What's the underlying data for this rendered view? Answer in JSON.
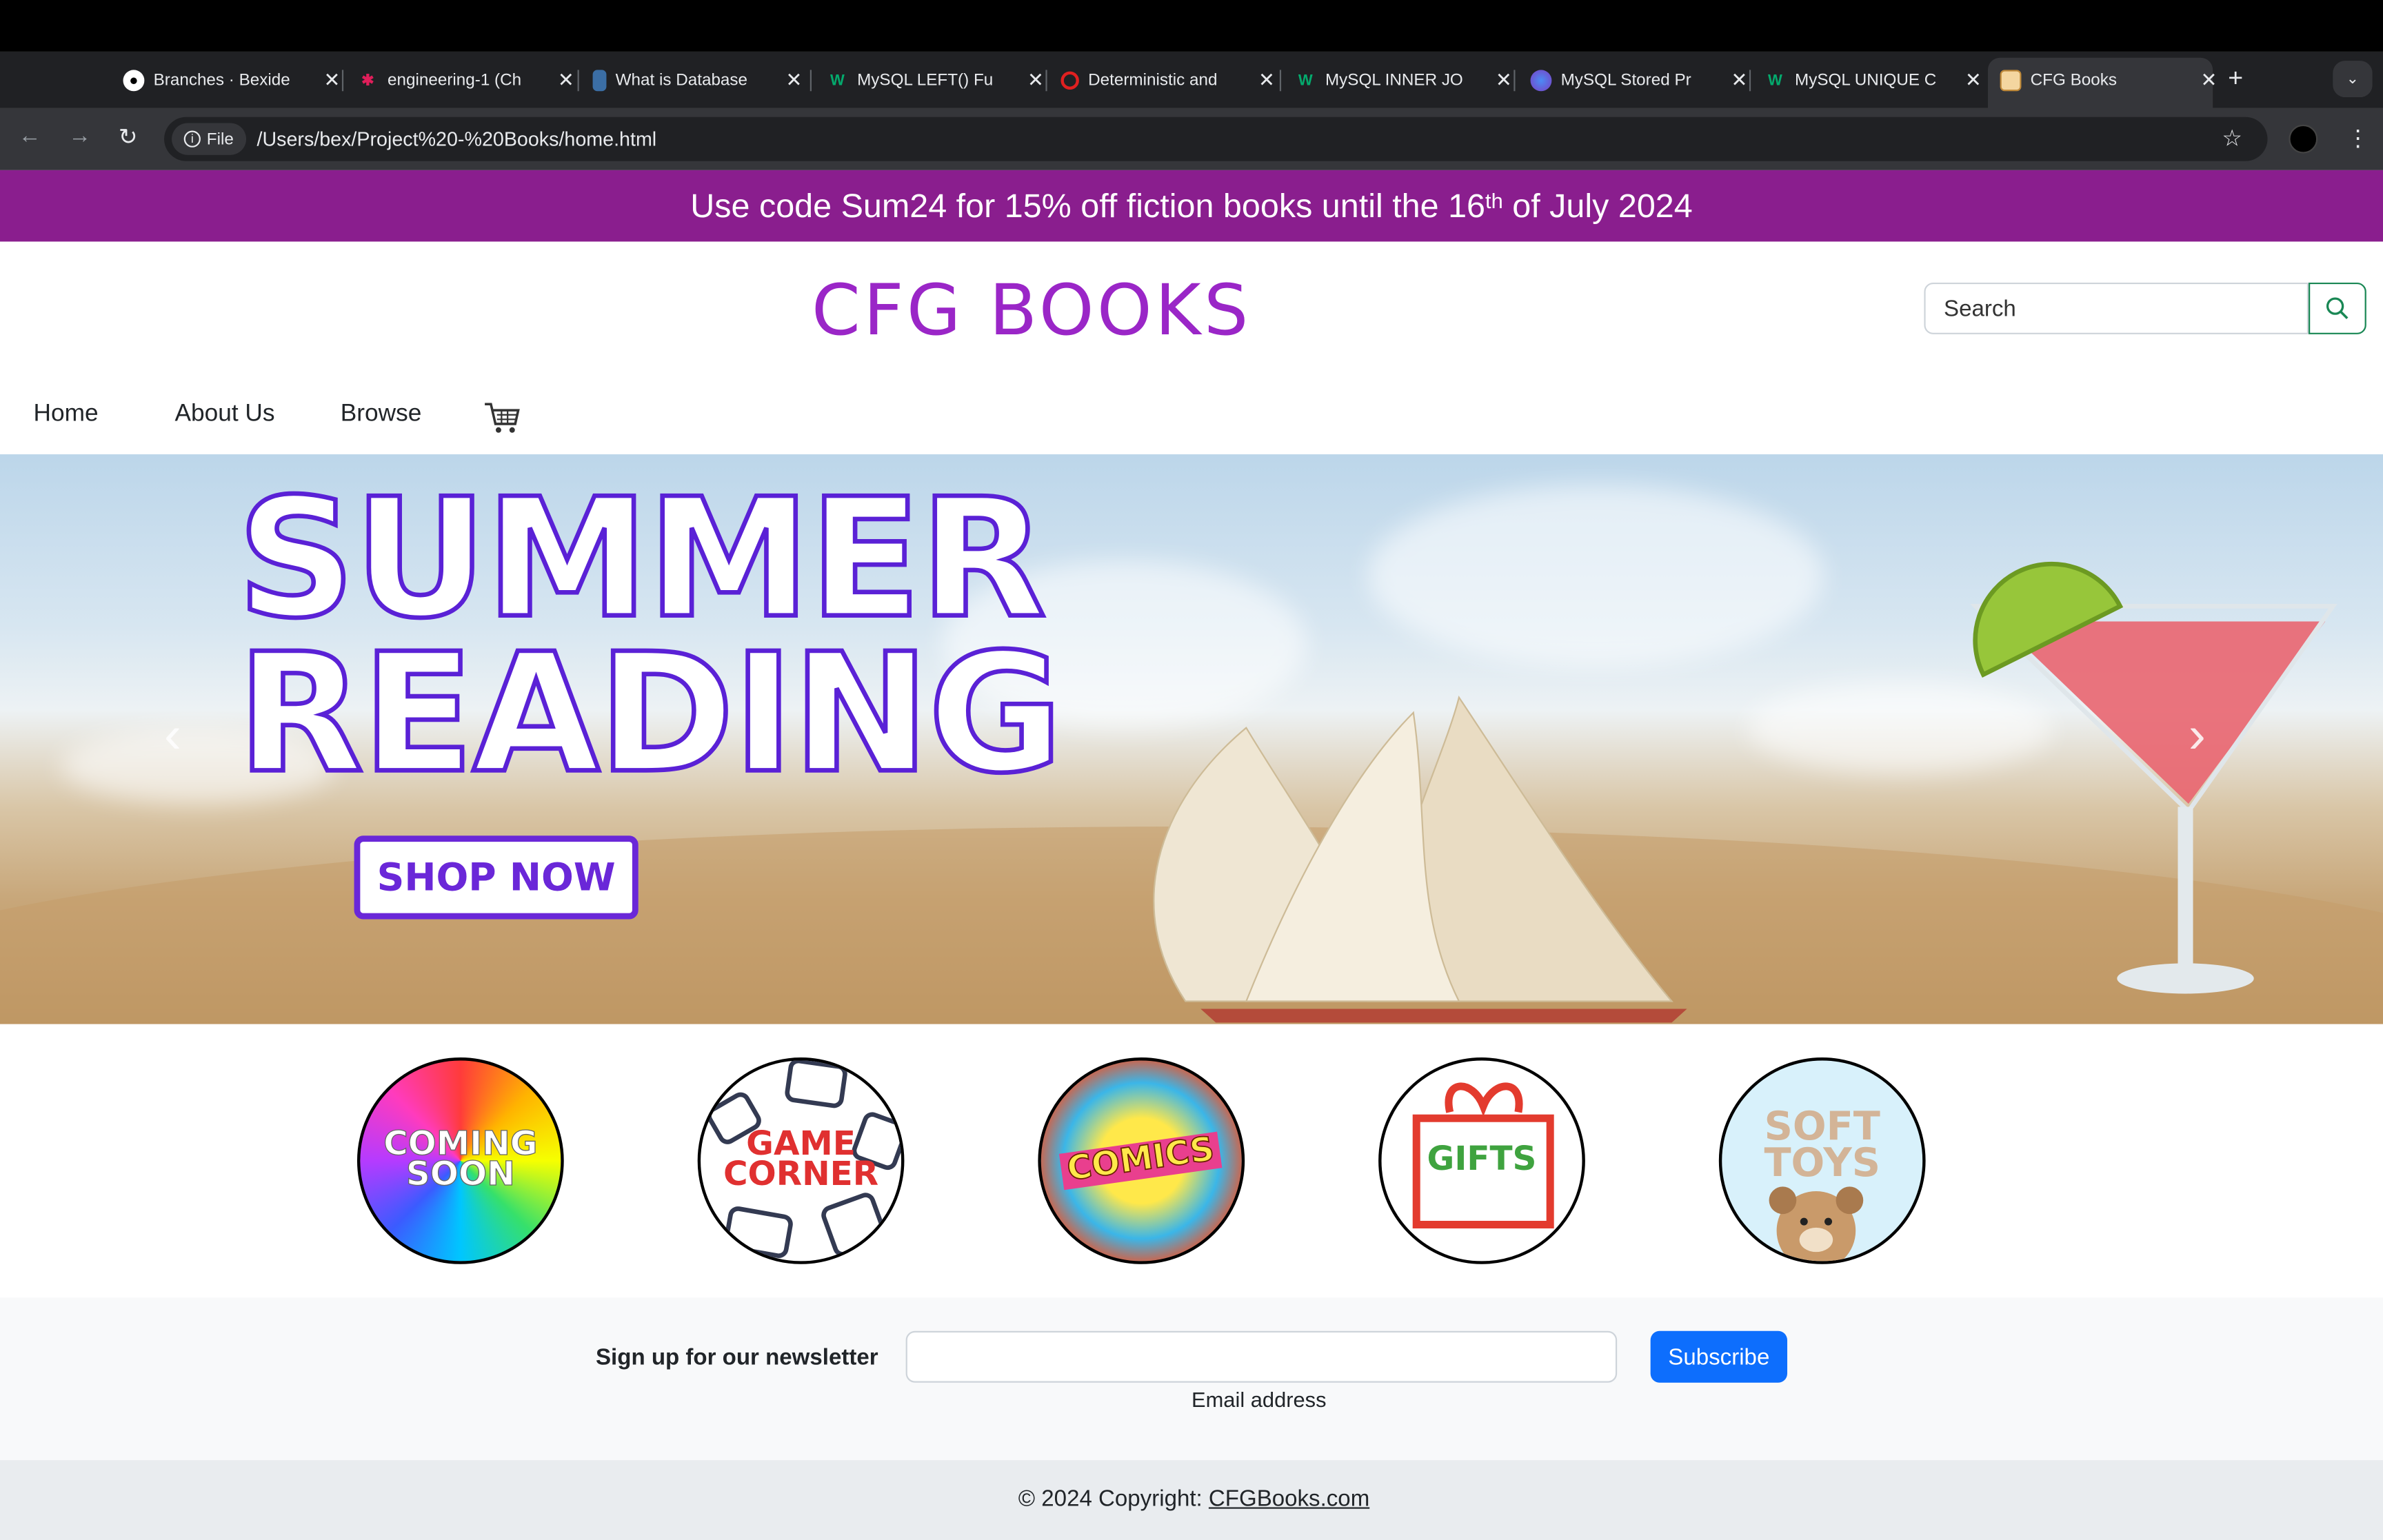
{
  "browser": {
    "tabs": [
      {
        "label": "Branches · Bexide",
        "icon": "github-icon"
      },
      {
        "label": "engineering-1 (Ch",
        "icon": "slack-icon"
      },
      {
        "label": "What is Database",
        "icon": "book-icon"
      },
      {
        "label": "MySQL LEFT() Fu",
        "icon": "w3schools-icon"
      },
      {
        "label": "Deterministic and",
        "icon": "oracle-icon"
      },
      {
        "label": "MySQL INNER JO",
        "icon": "w3schools-icon"
      },
      {
        "label": "MySQL Stored Pr",
        "icon": "globe-icon"
      },
      {
        "label": "MySQL UNIQUE C",
        "icon": "w3schools-icon"
      },
      {
        "label": "CFG Books",
        "icon": "site-icon"
      }
    ],
    "file_chip": "File",
    "url": "/Users/bex/Project%20-%20Books/home.html"
  },
  "promo": {
    "text_before": "Use code Sum24 for 15% off fiction books until the 16",
    "sup": "th",
    "text_after": " of July 2024"
  },
  "header": {
    "brand": "CFG BOOKS",
    "search_placeholder": "Search"
  },
  "nav": {
    "home": "Home",
    "about": "About Us",
    "browse": "Browse"
  },
  "hero": {
    "line1": "SUMMER",
    "line2": "READING",
    "cta": "SHOP NOW",
    "prev": "‹",
    "next": "›"
  },
  "categories": [
    {
      "line1": "COMING",
      "line2": "SOON"
    },
    {
      "line1": "GAME",
      "line2": "CORNER"
    },
    {
      "line1": "COMICS",
      "line2": ""
    },
    {
      "line1": "GIFTS",
      "line2": ""
    },
    {
      "line1": "SOFT",
      "line2": "TOYS"
    }
  ],
  "newsletter": {
    "label": "Sign up for our newsletter",
    "email_label": "Email address",
    "button": "Subscribe"
  },
  "footer": {
    "copyright": "© 2024 Copyright: ",
    "link": "CFGBooks.com"
  },
  "colors": {
    "promo_bg": "#8a1e8e",
    "brand": "#9a26c7",
    "subscribe": "#0d6efd"
  }
}
